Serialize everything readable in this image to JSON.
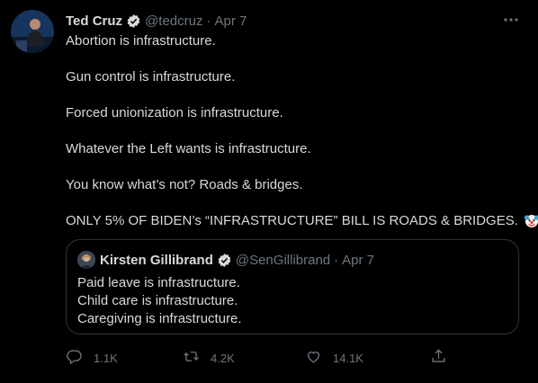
{
  "tweet": {
    "author_name": "Ted Cruz",
    "author_handle": "@tedcruz",
    "separator": "·",
    "date": "Apr 7",
    "lines": [
      "Abortion is infrastructure.",
      "Gun control is infrastructure.",
      "Forced unionization is infrastructure.",
      "Whatever the Left wants is infrastructure.",
      "You know what’s not?  Roads & bridges.",
      "ONLY 5% OF BIDEN’s “INFRASTRUCTURE” BILL IS ROADS & BRIDGES."
    ],
    "trailing_emoji": [
      "clown-face-icon",
      "clown-face-icon"
    ]
  },
  "quoted_tweet": {
    "author_name": "Kirsten Gillibrand",
    "author_handle": "@SenGillibrand",
    "separator": "·",
    "date": "Apr 7",
    "lines": [
      "Paid leave is infrastructure.",
      "Child care is infrastructure.",
      "Caregiving is infrastructure."
    ]
  },
  "actions": {
    "replies": "1.1K",
    "retweets": "4.2K",
    "likes": "14.1K"
  },
  "colors": {
    "background": "#000000",
    "text": "#d9d9d9",
    "secondary_text": "#6e767d",
    "border": "#2f3336",
    "verified_badge": "#d9d9d9"
  }
}
